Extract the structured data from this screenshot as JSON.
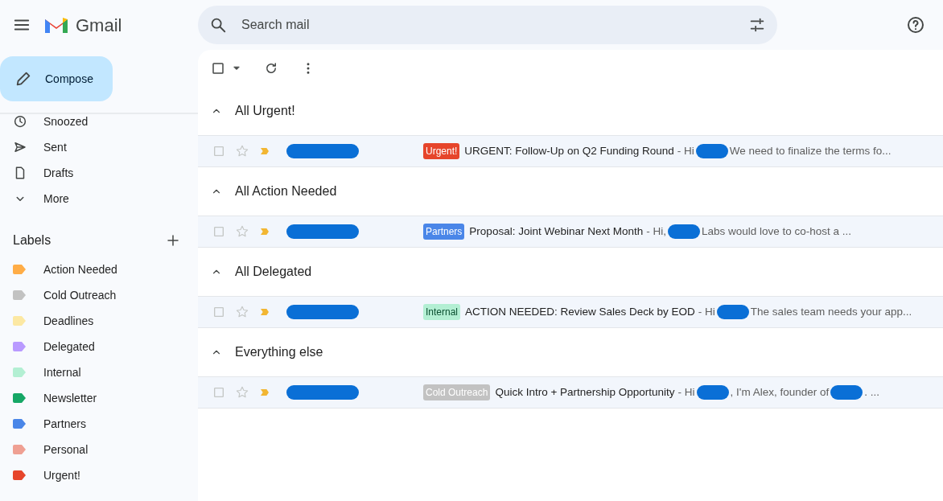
{
  "app": {
    "name": "Gmail"
  },
  "search": {
    "placeholder": "Search mail"
  },
  "compose": {
    "label": "Compose"
  },
  "nav": [
    {
      "label": "Snoozed",
      "kind": "snoozed"
    },
    {
      "label": "Sent",
      "kind": "sent"
    },
    {
      "label": "Drafts",
      "kind": "drafts"
    },
    {
      "label": "More",
      "kind": "more"
    }
  ],
  "labels": {
    "title": "Labels",
    "items": [
      {
        "label": "Action Needed",
        "color": "#ffad47"
      },
      {
        "label": "Cold Outreach",
        "color": "#c2c2c2"
      },
      {
        "label": "Deadlines",
        "color": "#fce8a3"
      },
      {
        "label": "Delegated",
        "color": "#b99aff"
      },
      {
        "label": "Internal",
        "color": "#b3efd3"
      },
      {
        "label": "Newsletter",
        "color": "#16a766"
      },
      {
        "label": "Partners",
        "color": "#4a86e8"
      },
      {
        "label": "Personal",
        "color": "#efa093"
      },
      {
        "label": "Urgent!",
        "color": "#e6452b"
      }
    ]
  },
  "sections": [
    {
      "title": "All Urgent!",
      "expanded": true,
      "rows": [
        {
          "tag": {
            "text": "Urgent!",
            "color": "#e6452b"
          },
          "subject": "URGENT: Follow-Up on Q2 Funding Round",
          "snippet": [
            "- Hi",
            "We need to finalize the terms fo..."
          ]
        }
      ]
    },
    {
      "title": "All Action Needed",
      "expanded": true,
      "rows": [
        {
          "tag": {
            "text": "Partners",
            "color": "#4a86e8"
          },
          "subject": "Proposal: Joint Webinar Next Month",
          "snippet": [
            "- Hi,",
            "Labs would love to co-host a ..."
          ]
        }
      ]
    },
    {
      "title": "All Delegated",
      "expanded": true,
      "rows": [
        {
          "tag": {
            "text": "Internal",
            "color": "#b3efd3"
          },
          "subject": "ACTION NEEDED: Review Sales Deck by EOD",
          "snippet": [
            "- Hi",
            "The sales team needs your app..."
          ]
        }
      ]
    },
    {
      "title": "Everything else",
      "expanded": true,
      "rows": [
        {
          "tag": {
            "text": "Cold Outreach",
            "color": "#c2c2c2"
          },
          "subject": "Quick Intro + Partnership Opportunity",
          "snippet": [
            "- Hi",
            ", I'm Alex, founder of",
            ". ..."
          ]
        }
      ]
    }
  ]
}
